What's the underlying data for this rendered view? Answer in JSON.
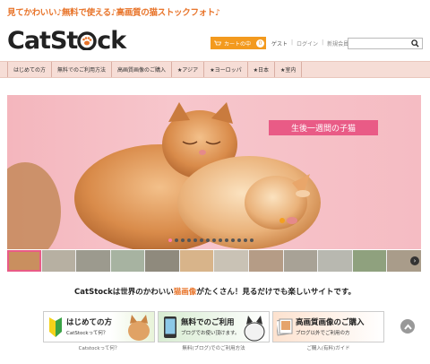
{
  "site": {
    "tagline": "見てかわいい♪無料で使える♪高画質の猫ストックフォト♪",
    "logo_text_a": "CatSt",
    "logo_text_b": "ck"
  },
  "header": {
    "cart_label": "カートの中",
    "cart_count": "0",
    "guest_label": "ゲスト",
    "login_label": "ログイン",
    "register_label": "新規会員登録",
    "search_placeholder": ""
  },
  "nav": {
    "items": [
      {
        "label": "はじめての方"
      },
      {
        "label": "無料でのご利用方法"
      },
      {
        "label": "高画質画像のご購入"
      },
      {
        "label": "★アジア"
      },
      {
        "label": "★ヨーロッパ"
      },
      {
        "label": "★日本"
      },
      {
        "label": "★室内"
      }
    ]
  },
  "hero": {
    "caption": "生後一週間の子猫",
    "slide_count": 14,
    "active_slide": 1
  },
  "intro": {
    "text_before": "CatStockは世界のかわいい",
    "text_highlight": "猫画像",
    "text_after": "がたくさん！見るだけでも楽しいサイトです。"
  },
  "banners": [
    {
      "title": "はじめての方",
      "subtitle": "CatStockって何？",
      "caption": "Catstockって何？"
    },
    {
      "title": "無料でのご利用",
      "subtitle": "ブログでお使い頂けます。",
      "caption": "無料(ブログ)でのご利用方法"
    },
    {
      "title": "高画質画像のご購入",
      "subtitle": "ブログ以外でご利用の方",
      "caption": "ご購入(有料)ガイド"
    }
  ],
  "colors": {
    "accent": "#e8742a",
    "nav_bg": "#f6ddd6",
    "hero_label": "#e95b86",
    "cart_bg": "#f39a1e"
  }
}
